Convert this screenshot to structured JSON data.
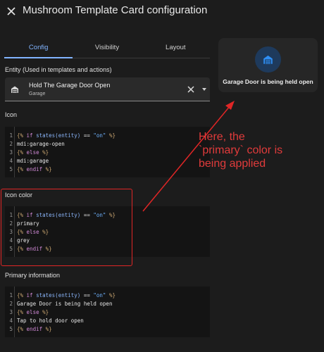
{
  "header": {
    "title": "Mushroom Template Card configuration"
  },
  "tabs": [
    {
      "label": "Config",
      "active": true
    },
    {
      "label": "Visibility",
      "active": false
    },
    {
      "label": "Layout",
      "active": false
    }
  ],
  "entity": {
    "label": "Entity (Used in templates and actions)",
    "name": "Hold The Garage Door Open",
    "secondary": "Garage"
  },
  "sections": {
    "icon": {
      "label": "Icon",
      "lines": [
        {
          "n": "1",
          "parts": [
            {
              "t": "{%",
              "c": "tag"
            },
            {
              "t": " if ",
              "c": "kw"
            },
            {
              "t": "states(entity)",
              "c": "fn"
            },
            {
              "t": " == ",
              "c": ""
            },
            {
              "t": "\"on\"",
              "c": "str"
            },
            {
              "t": " %}",
              "c": "tag"
            }
          ]
        },
        {
          "n": "2",
          "parts": [
            {
              "t": "mdi:garage-open",
              "c": ""
            }
          ]
        },
        {
          "n": "3",
          "parts": [
            {
              "t": "{%",
              "c": "tag"
            },
            {
              "t": " else ",
              "c": "kw"
            },
            {
              "t": "%}",
              "c": "tag"
            }
          ]
        },
        {
          "n": "4",
          "parts": [
            {
              "t": "mdi:garage",
              "c": ""
            }
          ]
        },
        {
          "n": "5",
          "parts": [
            {
              "t": "{%",
              "c": "tag"
            },
            {
              "t": " endif ",
              "c": "kw"
            },
            {
              "t": "%}",
              "c": "tag"
            }
          ]
        }
      ]
    },
    "icon_color": {
      "label": "Icon color",
      "lines": [
        {
          "n": "1",
          "parts": [
            {
              "t": "{%",
              "c": "tag"
            },
            {
              "t": " if ",
              "c": "kw"
            },
            {
              "t": "states(entity)",
              "c": "fn"
            },
            {
              "t": " == ",
              "c": ""
            },
            {
              "t": "\"on\"",
              "c": "str"
            },
            {
              "t": " %}",
              "c": "tag"
            }
          ]
        },
        {
          "n": "2",
          "parts": [
            {
              "t": "primary",
              "c": ""
            }
          ]
        },
        {
          "n": "3",
          "parts": [
            {
              "t": "{%",
              "c": "tag"
            },
            {
              "t": " else ",
              "c": "kw"
            },
            {
              "t": "%}",
              "c": "tag"
            }
          ]
        },
        {
          "n": "4",
          "parts": [
            {
              "t": "grey",
              "c": ""
            }
          ]
        },
        {
          "n": "5",
          "parts": [
            {
              "t": "{%",
              "c": "tag"
            },
            {
              "t": " endif ",
              "c": "kw"
            },
            {
              "t": "%}",
              "c": "tag"
            }
          ]
        }
      ]
    },
    "primary_info": {
      "label": "Primary information",
      "lines": [
        {
          "n": "1",
          "parts": [
            {
              "t": "{%",
              "c": "tag"
            },
            {
              "t": " if ",
              "c": "kw"
            },
            {
              "t": "states(entity)",
              "c": "fn"
            },
            {
              "t": " == ",
              "c": ""
            },
            {
              "t": "\"on\"",
              "c": "str"
            },
            {
              "t": " %}",
              "c": "tag"
            }
          ]
        },
        {
          "n": "2",
          "parts": [
            {
              "t": "Garage Door is being held open",
              "c": ""
            }
          ]
        },
        {
          "n": "3",
          "parts": [
            {
              "t": "{%",
              "c": "tag"
            },
            {
              "t": " else ",
              "c": "kw"
            },
            {
              "t": "%}",
              "c": "tag"
            }
          ]
        },
        {
          "n": "4",
          "parts": [
            {
              "t": "Tap to hold door open",
              "c": ""
            }
          ]
        },
        {
          "n": "5",
          "parts": [
            {
              "t": "{%",
              "c": "tag"
            },
            {
              "t": " endif ",
              "c": "kw"
            },
            {
              "t": "%}",
              "c": "tag"
            }
          ]
        }
      ]
    }
  },
  "preview": {
    "text": "Garage Door is being held open",
    "icon": "garage-icon"
  },
  "annotation": {
    "text": "Here, the\n`primary` color is\nbeing applied",
    "color": "#e02626"
  },
  "colors": {
    "accent": "#81b4ff",
    "background": "#1c1c1c",
    "icon_primary": "#2f8ff5"
  }
}
